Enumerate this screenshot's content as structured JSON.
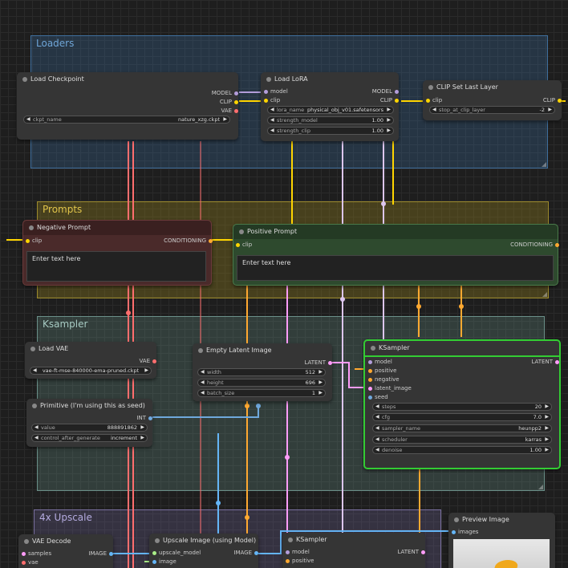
{
  "groups": {
    "loaders": "Loaders",
    "prompts": "Prompts",
    "ksampler": "Ksampler",
    "upscale": "4x Upscale"
  },
  "nodes": {
    "load_checkpoint": {
      "title": "Load Checkpoint",
      "outputs": [
        "MODEL",
        "CLIP",
        "VAE"
      ],
      "widget": {
        "label": "ckpt_name",
        "value": "nature_xzg.ckpt"
      }
    },
    "load_lora": {
      "title": "Load LoRA",
      "inputs": [
        "model",
        "clip"
      ],
      "outputs": [
        "MODEL",
        "CLIP"
      ],
      "widgets": [
        {
          "label": "lora_name",
          "value": "physical_obj_v01.safetensors"
        },
        {
          "label": "strength_model",
          "value": "1.00"
        },
        {
          "label": "strength_clip",
          "value": "1.00"
        }
      ]
    },
    "clip_set_last_layer": {
      "title": "CLIP Set Last Layer",
      "input": "clip",
      "output": "CLIP",
      "widget": {
        "label": "stop_at_clip_layer",
        "value": "-2"
      }
    },
    "negative_prompt": {
      "title": "Negative Prompt",
      "input": "clip",
      "output": "CONDITIONING",
      "text": "Enter text here"
    },
    "positive_prompt": {
      "title": "Positive Prompt",
      "input": "clip",
      "output": "CONDITIONING",
      "text": "Enter text here"
    },
    "load_vae": {
      "title": "Load VAE",
      "output": "VAE",
      "widget": {
        "label": "vae_name",
        "value": "vae-ft-mse-840000-ema-pruned.ckpt"
      }
    },
    "empty_latent": {
      "title": "Empty Latent Image",
      "output": "LATENT",
      "widgets": [
        {
          "label": "width",
          "value": "512"
        },
        {
          "label": "height",
          "value": "696"
        },
        {
          "label": "batch_size",
          "value": "1"
        }
      ]
    },
    "primitive": {
      "title": "Primitive (I'm using this as seed)",
      "output": "INT",
      "widgets": [
        {
          "label": "value",
          "value": "888891862"
        },
        {
          "label": "control_after_generate",
          "value": "increment"
        }
      ]
    },
    "ksampler": {
      "title": "KSampler",
      "inputs": [
        "model",
        "positive",
        "negative",
        "latent_image",
        "seed"
      ],
      "output": "LATENT",
      "widgets": [
        {
          "label": "steps",
          "value": "20"
        },
        {
          "label": "cfg",
          "value": "7.0"
        },
        {
          "label": "sampler_name",
          "value": "heunpp2"
        },
        {
          "label": "scheduler",
          "value": "karras"
        },
        {
          "label": "denoise",
          "value": "1.00"
        }
      ]
    },
    "preview_image": {
      "title": "Preview Image",
      "input": "images"
    },
    "vae_decode": {
      "title": "VAE Decode",
      "inputs": [
        "samples",
        "vae"
      ],
      "output": "IMAGE"
    },
    "upscale_image": {
      "title": "Upscale Image (using Model)",
      "inputs": [
        "upscale_model",
        "image"
      ],
      "output": "IMAGE"
    },
    "ksampler2": {
      "title": "KSampler",
      "inputs": [
        "model",
        "positive"
      ],
      "output": "LATENT"
    }
  },
  "arrows": {
    "left": "◀",
    "right": "▶"
  },
  "colors": {
    "model": "#b39ddb",
    "clip": "#ffd500",
    "vae": "#ff6e6e",
    "conditioning": "#ffa931",
    "latent": "#ff9cf9",
    "image": "#64b5f6",
    "int": "#6fa8dc",
    "upscale_model": "#aaee88"
  }
}
